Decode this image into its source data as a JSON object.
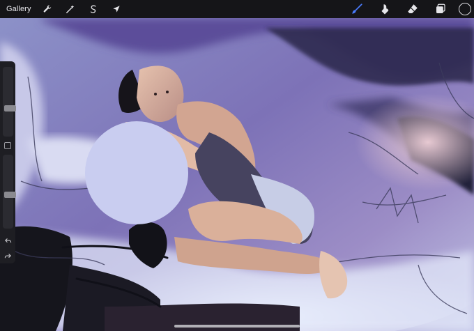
{
  "toolbar": {
    "gallery_label": "Gallery",
    "left_tools": [
      {
        "name": "adjustments",
        "icon": "wrench-icon"
      },
      {
        "name": "selection-effects",
        "icon": "magic-wand-icon"
      },
      {
        "name": "selection",
        "icon": "s-curve-icon"
      },
      {
        "name": "transform",
        "icon": "cursor-arrow-icon"
      }
    ],
    "right_tools": [
      {
        "name": "brush",
        "icon": "brush-icon",
        "active": true
      },
      {
        "name": "smudge",
        "icon": "smudge-icon",
        "active": false
      },
      {
        "name": "eraser",
        "icon": "eraser-icon",
        "active": false
      },
      {
        "name": "layers",
        "icon": "layers-icon",
        "active": false
      }
    ],
    "current_color": "#151518"
  },
  "sidebar": {
    "brush_size_level": 0.4,
    "opacity_level": 0.45
  },
  "colors": {
    "toolbar_bg": "#151518",
    "active_tool": "#4a7cff",
    "icon": "#e6e6ea",
    "swatch": "#c9cdf0"
  }
}
